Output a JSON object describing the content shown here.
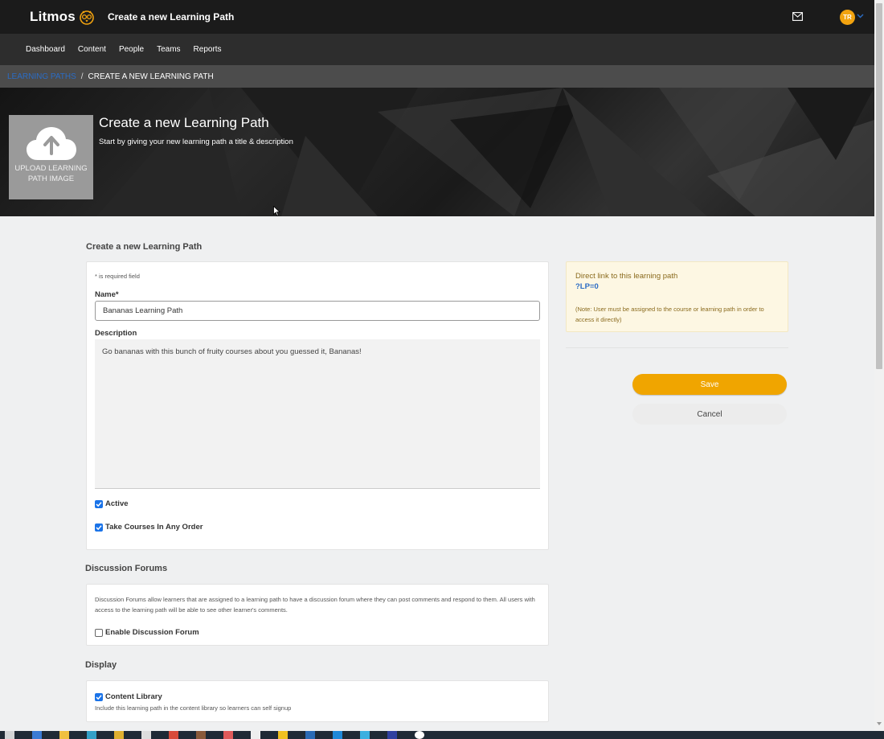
{
  "app": {
    "logo_text": "Litmos",
    "page_title": "Create a new Learning Path",
    "avatar_initials": "TR"
  },
  "nav": {
    "items": [
      "Dashboard",
      "Content",
      "People",
      "Teams",
      "Reports"
    ]
  },
  "breadcrumb": {
    "link": "Learning Paths",
    "separator": "/",
    "current": "Create a new Learning Path"
  },
  "hero": {
    "upload_label": "UPLOAD LEARNING PATH IMAGE",
    "title": "Create a new Learning Path",
    "subtitle": "Start by giving your new learning path a title & description"
  },
  "form": {
    "section_title": "Create a new Learning Path",
    "required_note": "* is required field",
    "name_label": "Name*",
    "name_value": "Bananas Learning Path",
    "description_label": "Description",
    "description_value": "Go bananas with this bunch of fruity courses about you guessed it, Bananas!",
    "active_label": "Active",
    "active_checked": true,
    "order_label": "Take Courses In Any Order",
    "order_checked": true
  },
  "discussion": {
    "section_title": "Discussion Forums",
    "description": "Discussion Forums allow learners that are assigned to a learning path to have a discussion forum where they can post comments and respond to them. All users with access to the learning path will be able to see other learner's comments.",
    "enable_label": "Enable Discussion Forum",
    "enable_checked": false
  },
  "display": {
    "section_title": "Display",
    "library_label": "Content Library",
    "library_checked": true,
    "library_help": "Include this learning path in the content library so learners can self signup"
  },
  "sidebar": {
    "link_title": "Direct link to this learning path",
    "link_value": "?LP=0",
    "note": "(Note: User must be assigned to the course or learning path in order to access it directly)",
    "save_label": "Save",
    "cancel_label": "Cancel"
  },
  "colors": {
    "accent": "#f0a500",
    "link": "#2b6cc4",
    "checkbox": "#1a73e8"
  }
}
